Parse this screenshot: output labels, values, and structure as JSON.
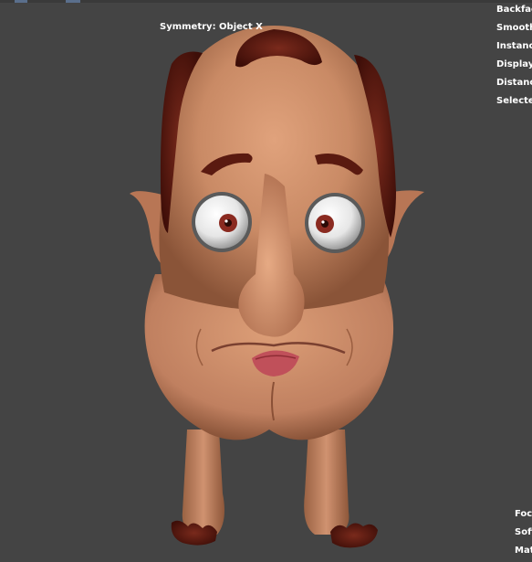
{
  "viewport": {
    "symmetry_label": "Symmetry: Object X",
    "side_labels": [
      "Backfac",
      "Smoothe",
      "Instance",
      "Display",
      "Distance",
      "Selecte"
    ],
    "bottom_labels": [
      "Foc",
      "Soft",
      "Mat"
    ]
  },
  "colors": {
    "background": "#444444",
    "skin": "#c98a65",
    "hair": "#5a1a10",
    "lips": "#c0505a"
  },
  "icons": {
    "model": "cartoon-head-3d-model"
  }
}
